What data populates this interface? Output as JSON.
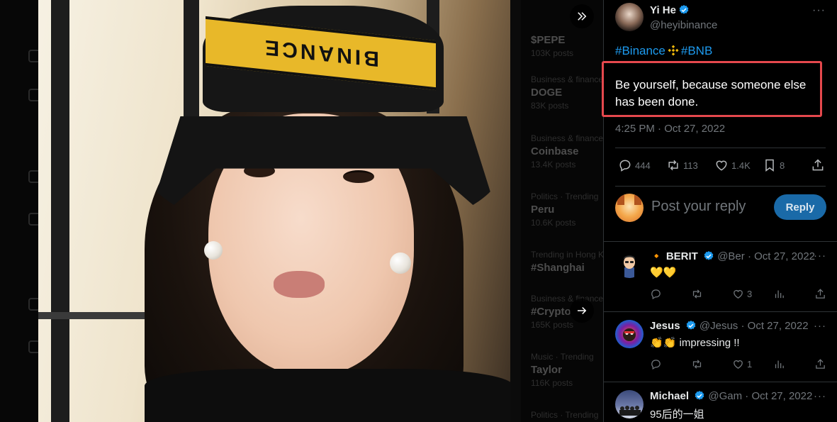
{
  "viewer": {
    "collapse_icon": "double-chevron-right-icon",
    "next_icon": "arrow-right-icon",
    "hat_text": "BINANCE"
  },
  "tweet": {
    "author_name": "Yi He",
    "author_handle": "@heyibinance",
    "hashtag_1": "#Binance",
    "hashtag_2": "#BNB",
    "text": "Be yourself, because someone else has been done.",
    "time": "4:25 PM · Oct 27, 2022",
    "stats": {
      "replies": "444",
      "retweets": "113",
      "likes": "1.4K",
      "bookmarks": "8"
    }
  },
  "reply_box": {
    "placeholder": "Post your reply",
    "button_label": "Reply"
  },
  "comments": [
    {
      "name": "🔸 BERIT",
      "handle": "@Ber",
      "date": "· Oct 27, 2022",
      "body": "💛💛",
      "replies": "",
      "retweets": "",
      "likes": "3"
    },
    {
      "name": "Jesus",
      "handle": "@Jesus",
      "date": "· Oct 27, 2022",
      "body": "👏👏 impressing !!",
      "replies": "",
      "retweets": "",
      "likes": "1"
    },
    {
      "name": "Michael",
      "handle": "@Gam",
      "date": "· Oct 27, 2022",
      "body": "95后的一姐"
    }
  ],
  "colors": {
    "accent": "#1d9bf0",
    "highlight_border": "#e5484d",
    "muted": "#71767b",
    "binance_yellow": "#f0b90b"
  }
}
